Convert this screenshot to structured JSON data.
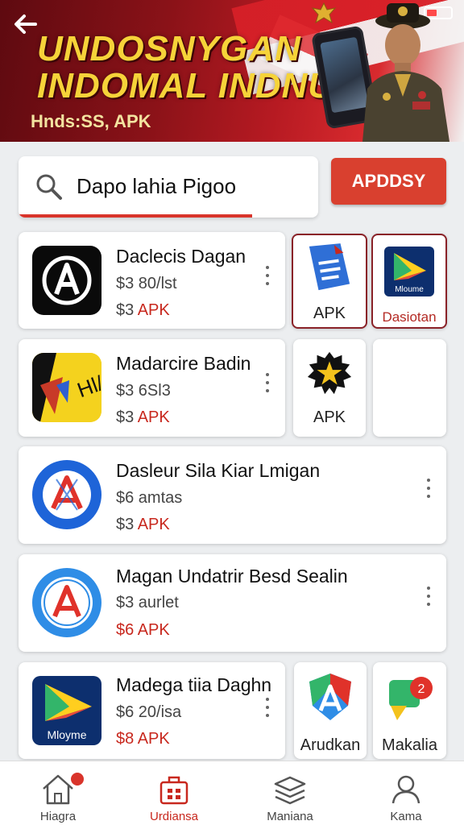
{
  "banner": {
    "title_line1": "UNDOSNYGAN",
    "title_line2": "INDOMAL INDNÚN",
    "subtitle": "Hnds:SS, APK"
  },
  "search": {
    "value": "Dapo lahia Pigoo",
    "button_label": "APDDSY"
  },
  "apps": [
    {
      "name": "Daclecis Dagan",
      "price": "$3 80/lst",
      "apk_currency": "$3",
      "apk_label": "APK",
      "icon": "letter-a-circle-icon"
    },
    {
      "name": "Madarcire Badin",
      "price": "$3 6Sl3",
      "apk_currency": "$3",
      "apk_label": "APK",
      "icon": "yellow-map-icon"
    },
    {
      "name": "Dasleur Sila Kiar Lmigan",
      "price": "$6 amtas",
      "apk_currency": "$3",
      "apk_label": "APK",
      "icon": "blue-a-circle-icon"
    },
    {
      "name": "Magan Undatrir Besd Sealin",
      "price": "$3 aurlet",
      "apk_currency": "$6",
      "apk_label": "APK",
      "icon": "app-store-a-icon"
    },
    {
      "name": "Madega tiia Daghn",
      "price": "$6 20/isa",
      "apk_currency": "$8",
      "apk_label": "APK",
      "icon": "play-triangle-icon",
      "icon_text": "Mloyme"
    }
  ],
  "tiles": [
    {
      "label": "APK",
      "icon": "document-apk-icon"
    },
    {
      "label": "Dasiotan",
      "icon": "play-triangle-icon",
      "icon_text": "Mloume"
    },
    {
      "label": "APK",
      "icon": "gold-star-badge-icon"
    },
    {
      "label": "",
      "icon": "none"
    },
    {
      "label": "Arudkan",
      "icon": "shield-a-icon"
    },
    {
      "label": "Makalia",
      "icon": "map-pin-icon"
    }
  ],
  "nav": [
    {
      "label": "Hiagra",
      "icon": "home-icon"
    },
    {
      "label": "Urdiansa",
      "icon": "briefcase-icon"
    },
    {
      "label": "Maniana",
      "icon": "stack-icon"
    },
    {
      "label": "Kama",
      "icon": "user-icon"
    }
  ],
  "colors": {
    "accent": "#d9402f",
    "apk_red": "#c8281e",
    "banner_dark": "#5e0a10",
    "banner_title": "#f6d339"
  }
}
